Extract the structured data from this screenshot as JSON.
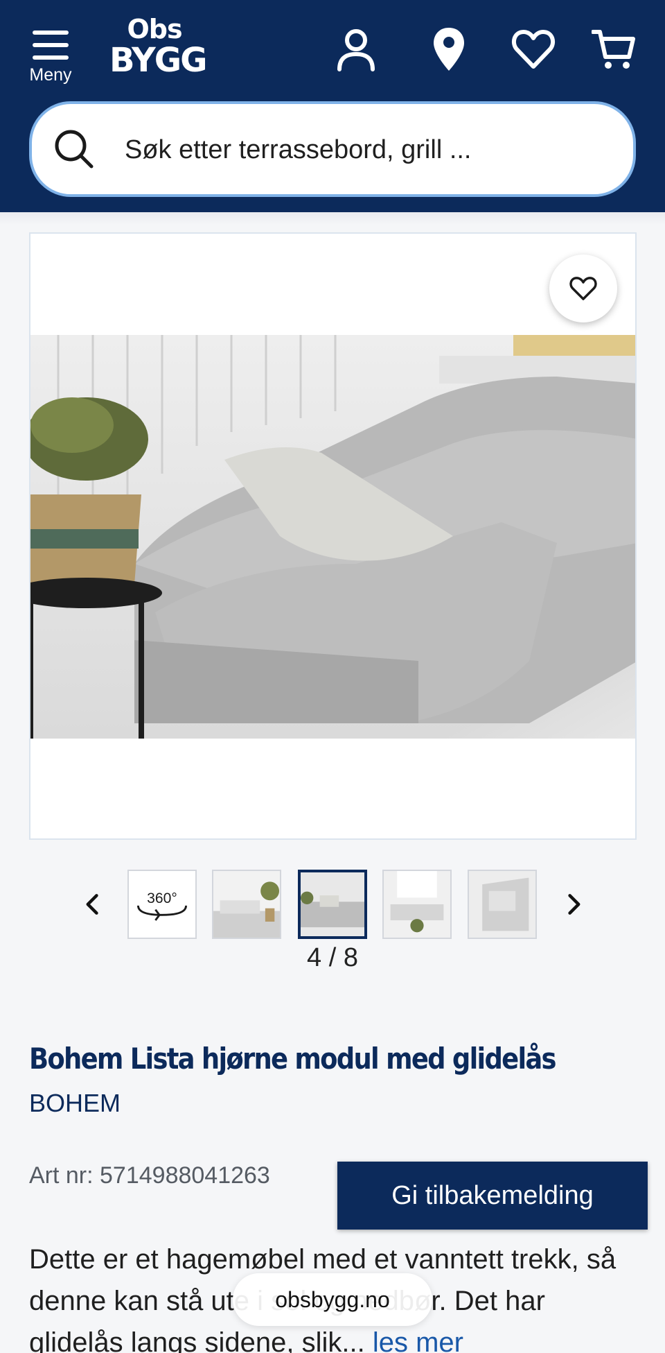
{
  "header": {
    "menu_label": "Meny",
    "logo_line1": "Obs",
    "logo_line2": "BYGG",
    "icons": [
      "user-icon",
      "location-pin-icon",
      "heart-icon",
      "cart-icon"
    ],
    "bg_color": "#0c2a5b"
  },
  "search": {
    "placeholder": "Søk etter terrassebord, grill ..."
  },
  "gallery": {
    "thumbnails": [
      {
        "name": "thumb-360",
        "label": "360°"
      },
      {
        "name": "thumb-2"
      },
      {
        "name": "thumb-3",
        "active": true
      },
      {
        "name": "thumb-4"
      },
      {
        "name": "thumb-5"
      }
    ],
    "counter": "4 / 8"
  },
  "product": {
    "title": "Bohem Lista hjørne modul med glidelås",
    "brand": "BOHEM",
    "art_nr": "Art nr: 5714988041263",
    "description": "Dette er et hagemøbel med et vanntett trekk, så denne kan stå ute i sol og nedbør. Det har glidelås langs sidene, slik...",
    "read_more": "les mer"
  },
  "feedback_button": "Gi tilbakemelding",
  "browser": {
    "url": "obsbygg.no"
  }
}
